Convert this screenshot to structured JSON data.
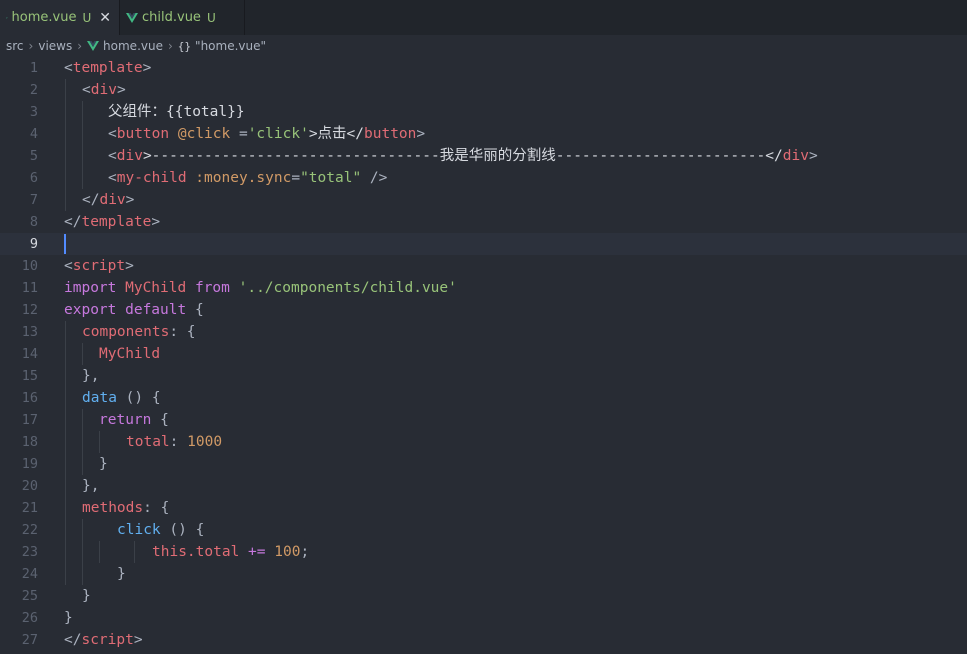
{
  "tabs": [
    {
      "name": "home.vue",
      "status": "U",
      "close": "✕",
      "active": true
    },
    {
      "name": "child.vue",
      "status": "U",
      "active": false
    }
  ],
  "breadcrumb": {
    "src": "src",
    "views": "views",
    "file": "home.vue",
    "braces": "{}",
    "symbol": "\"home.vue\"",
    "sep": "›"
  },
  "editor": {
    "current_line": 9,
    "lines": [
      {
        "n": "1"
      },
      {
        "n": "2"
      },
      {
        "n": "3"
      },
      {
        "n": "4"
      },
      {
        "n": "5"
      },
      {
        "n": "6"
      },
      {
        "n": "7"
      },
      {
        "n": "8"
      },
      {
        "n": "9"
      },
      {
        "n": "10"
      },
      {
        "n": "11"
      },
      {
        "n": "12"
      },
      {
        "n": "13"
      },
      {
        "n": "14"
      },
      {
        "n": "15"
      },
      {
        "n": "16"
      },
      {
        "n": "17"
      },
      {
        "n": "18"
      },
      {
        "n": "19"
      },
      {
        "n": "20"
      },
      {
        "n": "21"
      },
      {
        "n": "22"
      },
      {
        "n": "23"
      },
      {
        "n": "24"
      },
      {
        "n": "25"
      },
      {
        "n": "26"
      },
      {
        "n": "27"
      }
    ],
    "code": {
      "l1": {
        "a": "<",
        "b": "template",
        "c": ">"
      },
      "l2": {
        "a": "<",
        "b": "div",
        "c": ">"
      },
      "l3": {
        "a": "父组件：{{total}}"
      },
      "l4": {
        "a": "<",
        "b": "button",
        "c": " @click",
        "d": " =",
        "e": "'click'",
        "f": ">点击</",
        "g": "button",
        "h": ">"
      },
      "l5": {
        "a": "<",
        "b": "div",
        "c": ">---------------------------------我是华丽的分割线------------------------</",
        "d": "div",
        "e": ">"
      },
      "l6": {
        "a": "<",
        "b": "my-child",
        "c": " :money.sync",
        "d": "=",
        "e": "\"total\"",
        "f": " />"
      },
      "l7": {
        "a": "</",
        "b": "div",
        "c": ">"
      },
      "l8": {
        "a": "</",
        "b": "template",
        "c": ">"
      },
      "l10": {
        "a": "<",
        "b": "script",
        "c": ">"
      },
      "l11": {
        "a": "import",
        "b": " MyChild",
        "c": " from",
        "d": " '../components/child.vue'"
      },
      "l12": {
        "a": "export",
        "b": " default",
        "c": " {"
      },
      "l13": {
        "a": "components",
        "b": ": {"
      },
      "l14": {
        "a": "MyChild"
      },
      "l15": {
        "a": "},"
      },
      "l16": {
        "a": "data",
        "b": " () {"
      },
      "l17": {
        "a": "return",
        "b": " {"
      },
      "l18": {
        "a": "total",
        "b": ": ",
        "c": "1000"
      },
      "l19": {
        "a": "}"
      },
      "l20": {
        "a": "},"
      },
      "l21": {
        "a": "methods",
        "b": ": {"
      },
      "l22": {
        "a": "click",
        "b": " () {"
      },
      "l23": {
        "a": "this",
        "b": ".total",
        "c": " +=",
        "d": " 100",
        "e": ";"
      },
      "l24": {
        "a": "}"
      },
      "l25": {
        "a": "}"
      },
      "l26": {
        "a": "}"
      },
      "l27": {
        "a": "</",
        "b": "script",
        "c": ">"
      }
    }
  },
  "colors": {
    "background": "#282c34",
    "tag": "#e06c75",
    "keyword": "#c678dd",
    "string": "#98c379",
    "number": "#d19a66",
    "function": "#61afef",
    "vue_green": "#41b883"
  },
  "icons": {
    "vue": "vue-logo-icon",
    "close": "close-icon"
  }
}
